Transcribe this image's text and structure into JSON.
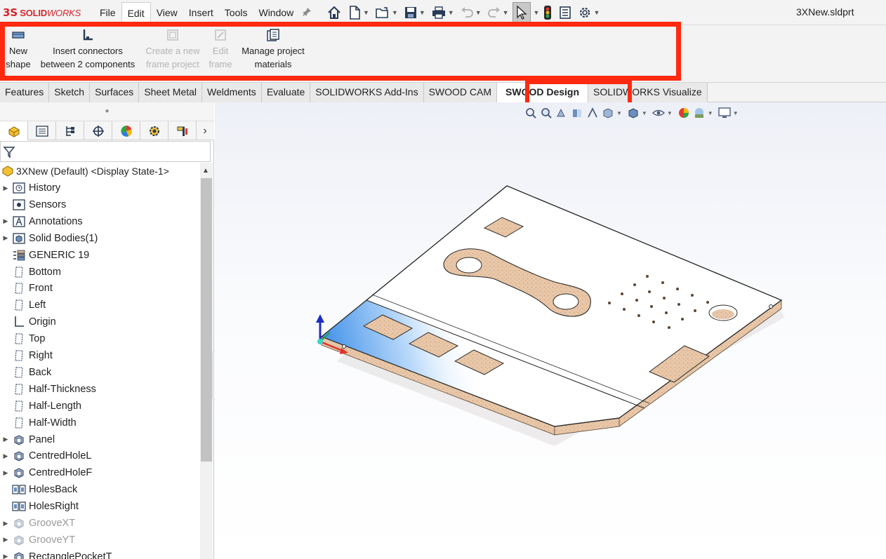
{
  "app": {
    "logo_mark": "3S",
    "logo_bold": "SOLID",
    "logo_italic": "WORKS",
    "document_title": "3XNew.sldprt"
  },
  "menu": {
    "items": [
      "File",
      "Edit",
      "View",
      "Insert",
      "Tools",
      "Window"
    ],
    "active": "Edit"
  },
  "ribbon": {
    "buttons": [
      {
        "line1": "New",
        "line2": "shape",
        "enabled": true
      },
      {
        "line1": "Insert connectors",
        "line2": "between 2 components",
        "enabled": true
      },
      {
        "line1": "Create a new",
        "line2": "frame project",
        "enabled": false
      },
      {
        "line1": "Edit",
        "line2": "frame",
        "enabled": false
      },
      {
        "line1": "Manage project",
        "line2": "materials",
        "enabled": true
      }
    ],
    "highlight_color": "#ff2a10"
  },
  "tabs": {
    "items": [
      "Features",
      "Sketch",
      "Surfaces",
      "Sheet Metal",
      "Weldments",
      "Evaluate",
      "SOLIDWORKS Add-Ins",
      "SWOOD CAM",
      "SWOOD Design",
      "SOLIDWORKS Visualize"
    ],
    "active": "SWOOD Design"
  },
  "tree": {
    "root": "3XNew (Default) <Display State-1>",
    "items": [
      {
        "label": "History",
        "icon": "history-icon",
        "expandable": true,
        "grey": false
      },
      {
        "label": "Sensors",
        "icon": "sensors-icon",
        "expandable": false,
        "grey": false
      },
      {
        "label": "Annotations",
        "icon": "annotations-icon",
        "expandable": true,
        "grey": false
      },
      {
        "label": "Solid Bodies(1)",
        "icon": "solid-bodies-icon",
        "expandable": true,
        "grey": false
      },
      {
        "label": "GENERIC 19",
        "icon": "material-icon",
        "expandable": false,
        "grey": false
      },
      {
        "label": "Bottom",
        "icon": "plane-icon",
        "expandable": false,
        "grey": false
      },
      {
        "label": "Front",
        "icon": "plane-icon",
        "expandable": false,
        "grey": false
      },
      {
        "label": "Left",
        "icon": "plane-icon",
        "expandable": false,
        "grey": false
      },
      {
        "label": "Origin",
        "icon": "origin-icon",
        "expandable": false,
        "grey": false
      },
      {
        "label": "Top",
        "icon": "plane-icon",
        "expandable": false,
        "grey": false
      },
      {
        "label": "Right",
        "icon": "plane-icon",
        "expandable": false,
        "grey": false
      },
      {
        "label": "Back",
        "icon": "plane-icon",
        "expandable": false,
        "grey": false
      },
      {
        "label": "Half-Thickness",
        "icon": "plane-icon",
        "expandable": false,
        "grey": false
      },
      {
        "label": "Half-Length",
        "icon": "plane-icon",
        "expandable": false,
        "grey": false
      },
      {
        "label": "Half-Width",
        "icon": "plane-icon",
        "expandable": false,
        "grey": false
      },
      {
        "label": "Panel",
        "icon": "feature-icon",
        "expandable": true,
        "grey": false
      },
      {
        "label": "CentredHoleL",
        "icon": "feature-icon",
        "expandable": true,
        "grey": false
      },
      {
        "label": "CentredHoleF",
        "icon": "feature-icon",
        "expandable": true,
        "grey": false
      },
      {
        "label": "HolesBack",
        "icon": "pattern-icon",
        "expandable": false,
        "grey": false
      },
      {
        "label": "HolesRight",
        "icon": "pattern-icon",
        "expandable": false,
        "grey": false
      },
      {
        "label": "GrooveXT",
        "icon": "feature-icon",
        "expandable": true,
        "grey": true
      },
      {
        "label": "GrooveYT",
        "icon": "feature-icon",
        "expandable": true,
        "grey": true
      },
      {
        "label": "RectanglePocketT",
        "icon": "feature-icon",
        "expandable": true,
        "grey": false
      }
    ]
  },
  "colors": {
    "accent_red": "#d6262d",
    "wood": "#e6c3a6",
    "selection_blue": "#3c8ee8"
  }
}
